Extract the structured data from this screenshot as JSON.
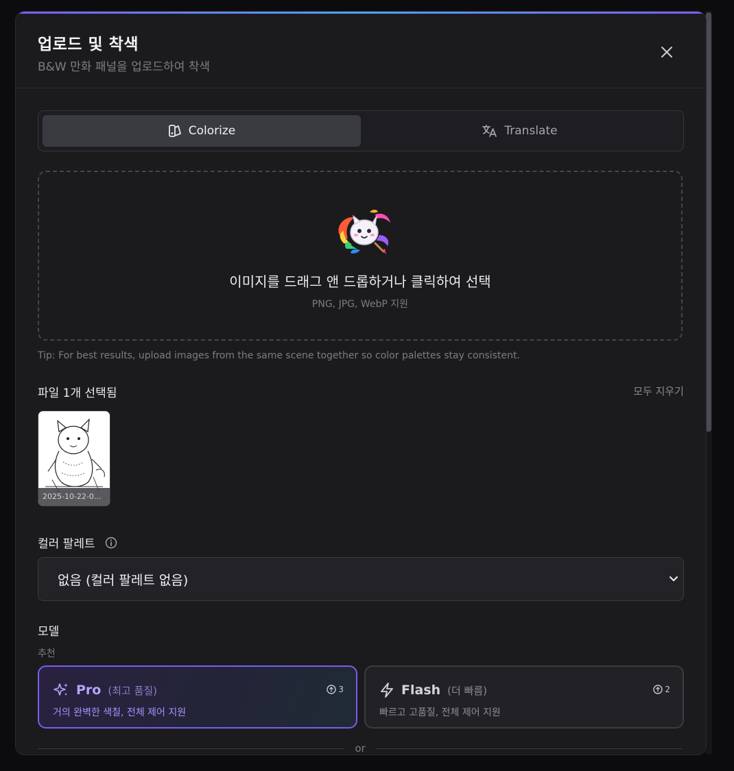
{
  "header": {
    "title": "업로드 및 착색",
    "subtitle": "B&W 만화 패널을 업로드하여 착색"
  },
  "tabs": [
    {
      "label": "Colorize",
      "icon": "palette-icon",
      "active": true
    },
    {
      "label": "Translate",
      "icon": "translate-icon",
      "active": false
    }
  ],
  "dropzone": {
    "prompt": "이미지를 드래그 앤 드롭하거나 클릭하여 선택",
    "formats": "PNG, JPG, WebP 지원"
  },
  "tip": "Tip: For best results, upload images from the same scene together so color palettes stay consistent.",
  "files": {
    "label": "파일 1개 선택됨",
    "clear_label": "모두 지우기",
    "items": [
      {
        "name": "2025-10-22-0..."
      }
    ]
  },
  "palette": {
    "label": "컬러 팔레트",
    "selected": "없음 (컬러 팔레트 없음)"
  },
  "model": {
    "label": "모델",
    "recommended_label": "추천",
    "options": [
      {
        "name": "Pro",
        "quality": "(최고 품질)",
        "description": "거의 완벽한 색칠, 전체 제어 지원",
        "cost": "3",
        "selected": true
      },
      {
        "name": "Flash",
        "quality": "(더 빠름)",
        "description": "빠르고 고품질, 전체 제어 지원",
        "cost": "2",
        "selected": false
      }
    ]
  },
  "divider_text": "or",
  "colors": {
    "accent": "#7b5cf0",
    "background": "#1b1b1e"
  }
}
